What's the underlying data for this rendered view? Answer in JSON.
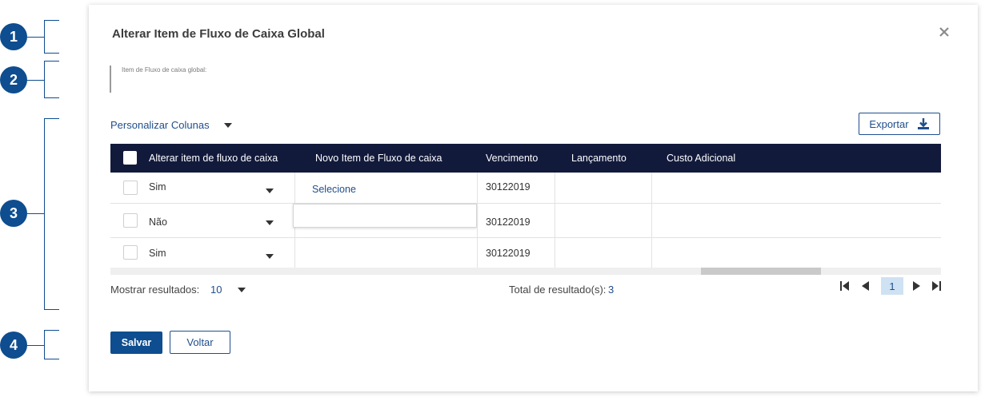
{
  "annotations": [
    "1",
    "2",
    "3",
    "4"
  ],
  "modal": {
    "title": "Alterar Item de Fluxo de Caixa Global",
    "close_icon": "close-icon",
    "field_label": "Item de Fluxo de caixa global:",
    "personalize_columns": "Personalizar Colunas",
    "export_label": "Exportar",
    "export_icon": "download-icon"
  },
  "table": {
    "headers": [
      "Alterar item de fluxo de caixa",
      "Novo Item de Fluxo de caixa",
      "Vencimento",
      "Lançamento",
      "Custo Adicional"
    ],
    "rows": [
      {
        "alterar": "Sim",
        "novo_item": "Selecione",
        "vencimento": "30122019",
        "lancamento": "",
        "custo_adicional": ""
      },
      {
        "alterar": "Não",
        "novo_item": "",
        "vencimento": "30122019",
        "lancamento": "",
        "custo_adicional": ""
      },
      {
        "alterar": "Sim",
        "novo_item": "",
        "vencimento": "30122019",
        "lancamento": "",
        "custo_adicional": ""
      }
    ]
  },
  "footer": {
    "show_results_label": "Mostrar resultados:",
    "show_results_value": "10",
    "total_label": "Total de resultado(s):",
    "total_value": "3",
    "current_page": "1"
  },
  "actions": {
    "save": "Salvar",
    "back": "Voltar"
  },
  "colors": {
    "primary": "#0e4d8f",
    "table_header": "#121a3c",
    "link": "#1f4e8c"
  }
}
